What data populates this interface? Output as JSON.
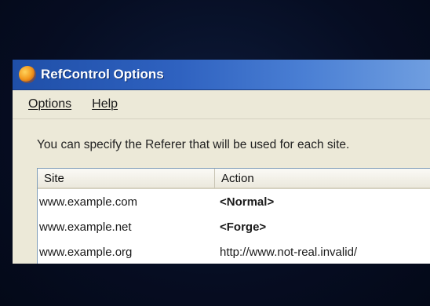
{
  "window": {
    "title": "RefControl Options",
    "icon": "firefox-icon"
  },
  "menu": [
    {
      "label": "Options"
    },
    {
      "label": "Help"
    }
  ],
  "description": "You can specify the Referer that will be used for each site.",
  "table": {
    "columns": [
      "Site",
      "Action"
    ],
    "rows": [
      {
        "site": "www.example.com",
        "action": "<Normal>",
        "bold": true
      },
      {
        "site": "www.example.net",
        "action": "<Forge>",
        "bold": true
      },
      {
        "site": "www.example.org",
        "action": "http://www.not-real.invalid/",
        "bold": false
      }
    ]
  }
}
